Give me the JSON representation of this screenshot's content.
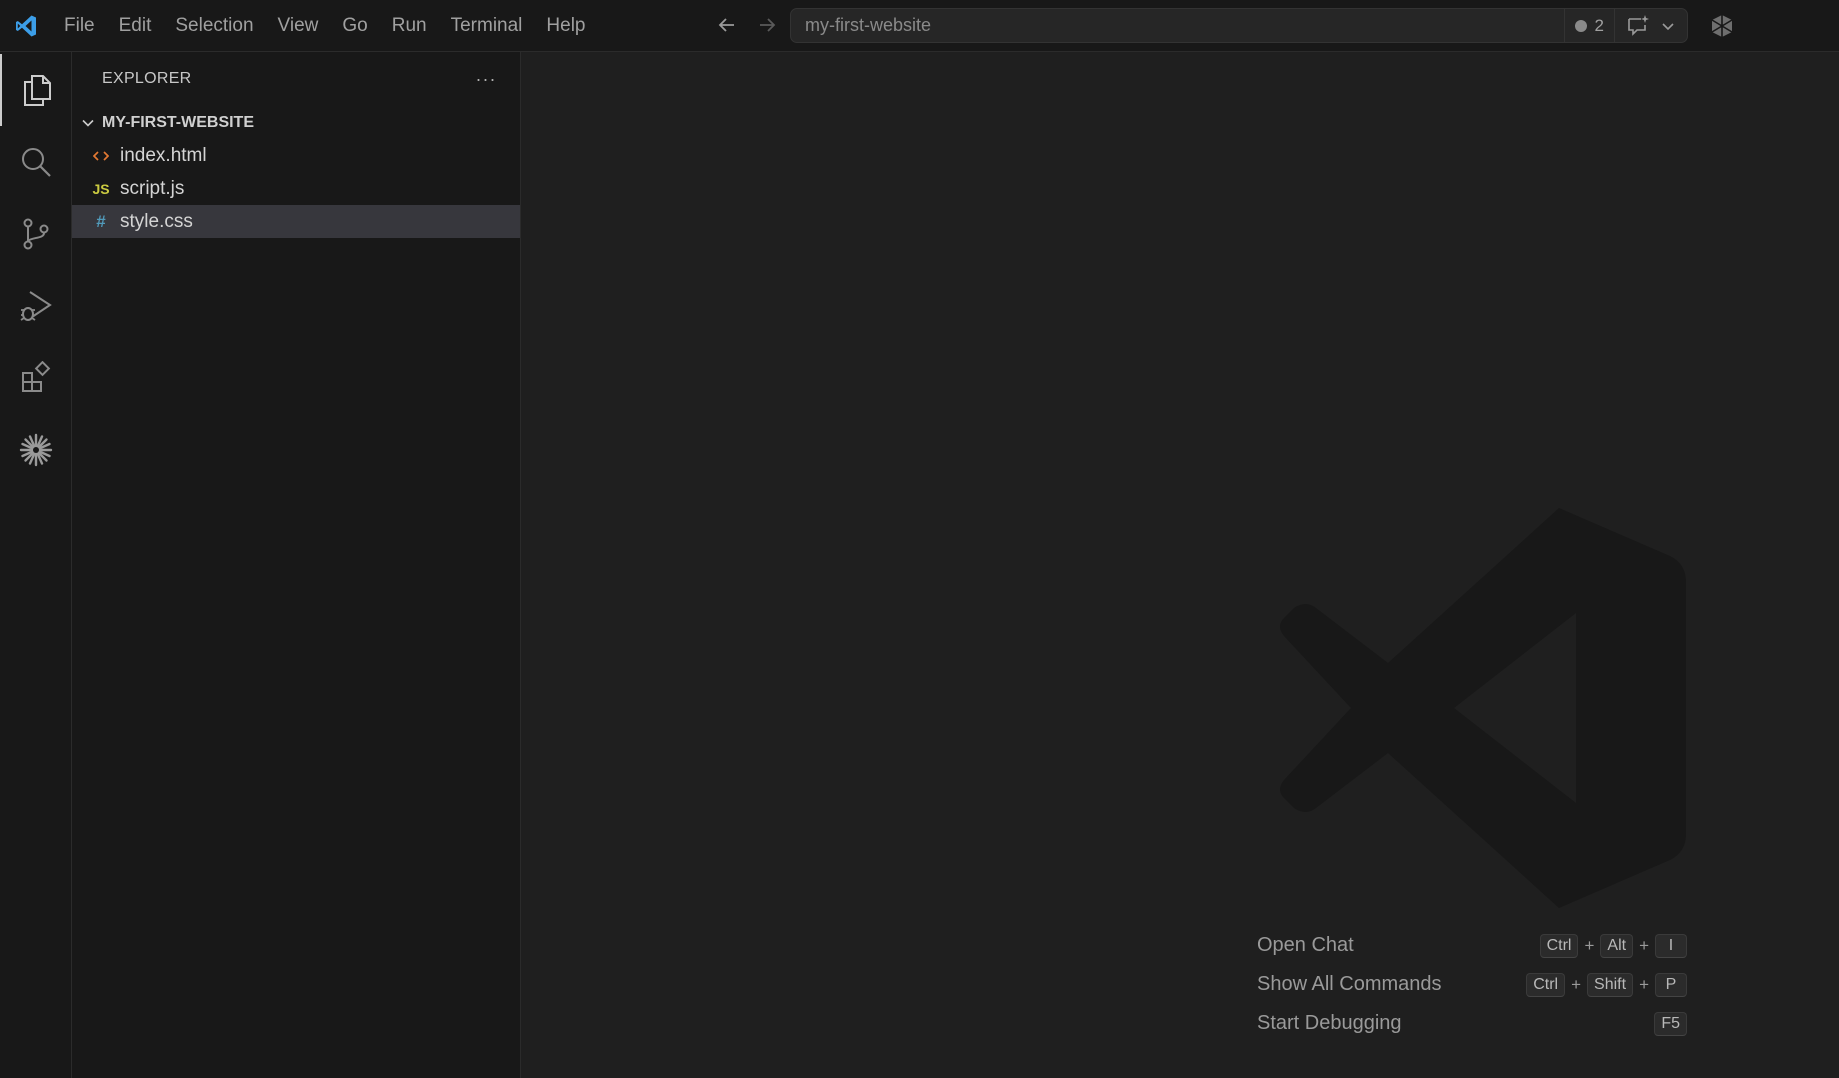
{
  "titlebar": {
    "menu": [
      "File",
      "Edit",
      "Selection",
      "View",
      "Go",
      "Run",
      "Terminal",
      "Help"
    ],
    "command_center_label": "my-first-website",
    "notification_count": "2",
    "accent": "#3c9ee8"
  },
  "activitybar": {
    "items": [
      "explorer-icon",
      "search-icon",
      "source-control-icon",
      "run-debug-icon",
      "extensions-icon",
      "ai-sparkle-icon"
    ]
  },
  "sidebar": {
    "title": "EXPLORER",
    "more": "···",
    "folder": "MY-FIRST-WEBSITE",
    "files": [
      {
        "name": "index.html",
        "icon": "<>",
        "color": "#e37933"
      },
      {
        "name": "script.js",
        "icon": "JS",
        "color": "#cbcb41"
      },
      {
        "name": "style.css",
        "icon": "#",
        "color": "#519aba"
      }
    ]
  },
  "editor": {
    "shortcuts": [
      {
        "label": "Open Chat",
        "keys": [
          "Ctrl",
          "Alt",
          "I"
        ]
      },
      {
        "label": "Show All Commands",
        "keys": [
          "Ctrl",
          "Shift",
          "P"
        ]
      },
      {
        "label": "Start Debugging",
        "keys": [
          "F5"
        ]
      }
    ],
    "plus": "+"
  }
}
